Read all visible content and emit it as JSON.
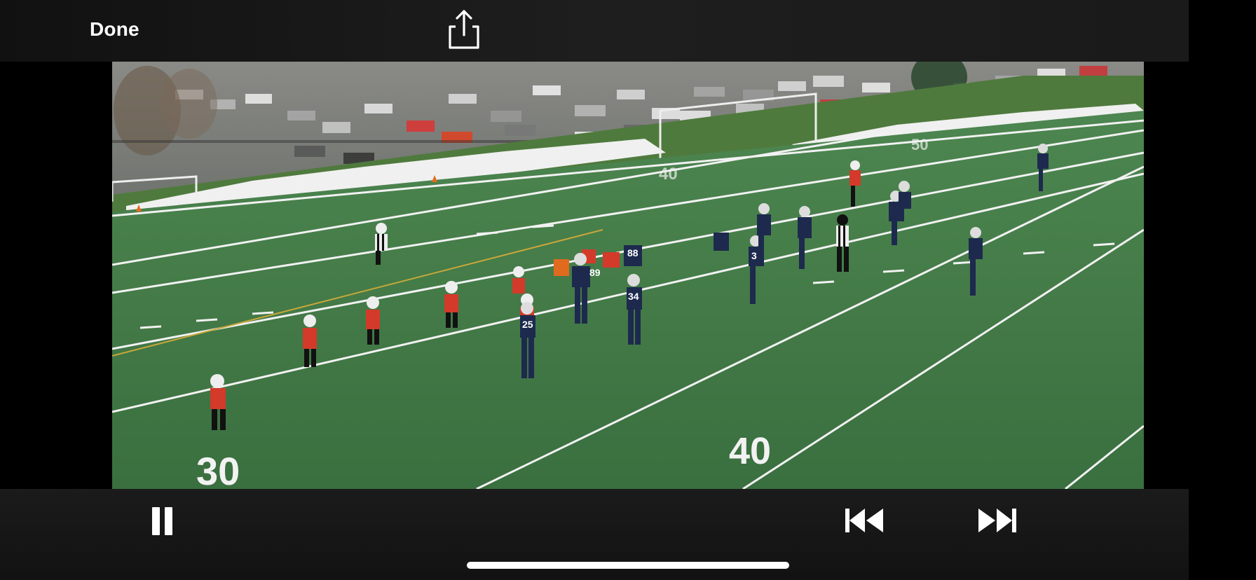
{
  "top_bar": {
    "done_label": "Done",
    "share_icon": "share-icon"
  },
  "video": {
    "field_numbers": [
      "30",
      "40",
      "40",
      "50"
    ],
    "jersey_numbers": [
      "89",
      "88",
      "25",
      "34",
      "3"
    ]
  },
  "controls": {
    "pause_icon": "pause-icon",
    "skip_back_icon": "skip-back-icon",
    "skip_forward_icon": "skip-forward-icon"
  },
  "colors": {
    "turf": "#3f7a45",
    "home_team": "#d33a2a",
    "away_team": "#1d2a4e"
  }
}
